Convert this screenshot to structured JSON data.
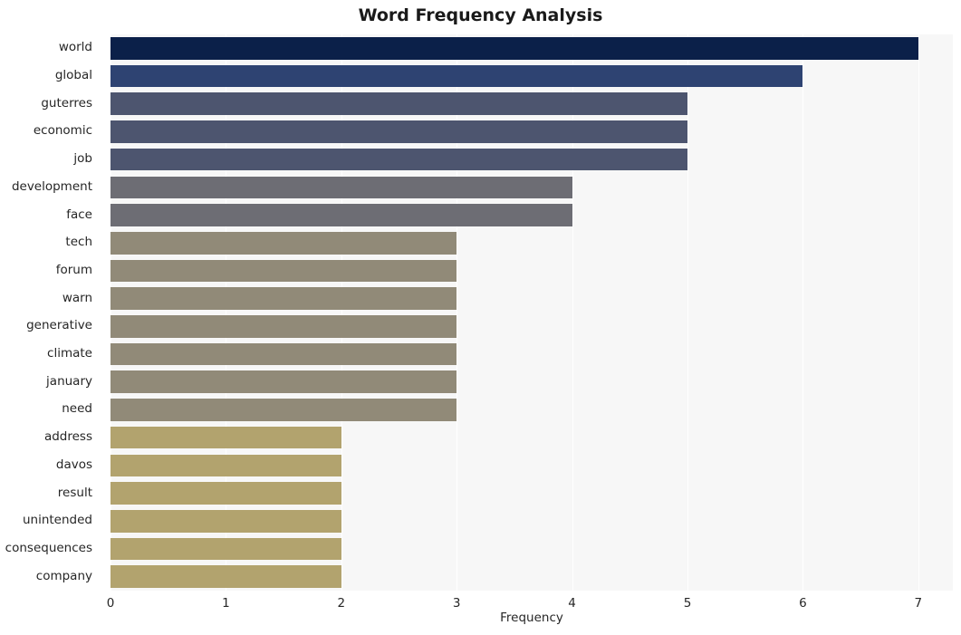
{
  "chart_data": {
    "type": "bar",
    "orientation": "horizontal",
    "title": "Word Frequency Analysis",
    "xlabel": "Frequency",
    "ylabel": "",
    "xlim": [
      0,
      7.3
    ],
    "xticks": [
      0,
      1,
      2,
      3,
      4,
      5,
      6,
      7
    ],
    "grid": true,
    "grid_axis": "x",
    "legend": false,
    "categories": [
      "world",
      "global",
      "guterres",
      "economic",
      "job",
      "development",
      "face",
      "tech",
      "forum",
      "warn",
      "generative",
      "climate",
      "january",
      "need",
      "address",
      "davos",
      "result",
      "unintended",
      "consequences",
      "company"
    ],
    "values": [
      7,
      6,
      5,
      5,
      5,
      4,
      4,
      3,
      3,
      3,
      3,
      3,
      3,
      3,
      2,
      2,
      2,
      2,
      2,
      2
    ],
    "bar_colors": [
      "#0b2049",
      "#2e4372",
      "#4d556f",
      "#4d556f",
      "#4d556f",
      "#6d6d74",
      "#6d6d74",
      "#918a78",
      "#918a78",
      "#918a78",
      "#918a78",
      "#918a78",
      "#918a78",
      "#918a78",
      "#b2a36e",
      "#b2a36e",
      "#b2a36e",
      "#b2a36e",
      "#b2a36e",
      "#b2a36e"
    ],
    "plot_background": "#f7f7f7",
    "figure_background": "#ffffff"
  }
}
